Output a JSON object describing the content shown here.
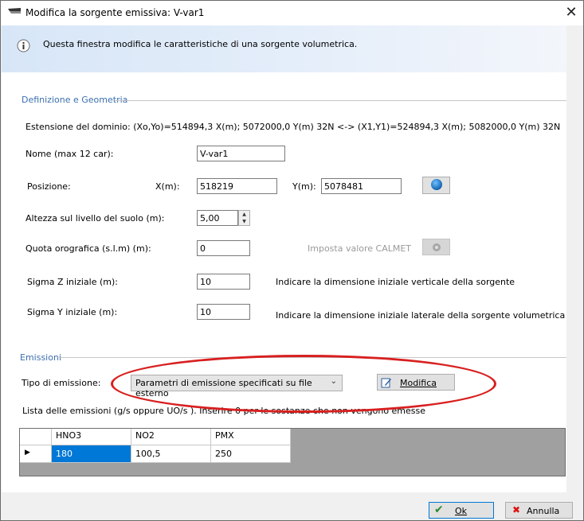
{
  "window": {
    "title": "Modifica la sorgente emissiva: V-var1",
    "close_icon": "close-icon"
  },
  "banner": {
    "text": "Questa finestra modifica le caratteristiche di una sorgente volumetrica.",
    "icon": "info-icon"
  },
  "geometry": {
    "group_title": "Definizione e Geometria",
    "domain_extent": "Estensione del dominio: (Xo,Yo)=514894,3 X(m); 5072000,0 Y(m) 32N  <-> (X1,Y1)=524894,3 X(m); 5082000,0 Y(m) 32N",
    "name_label": "Nome (max 12 car):",
    "name_value": "V-var1",
    "position_label": "Posizione:",
    "x_label": "X(m):",
    "x_value": "518219",
    "y_label": "Y(m):",
    "y_value": "5078481",
    "globe_icon": "globe-icon",
    "height_label": "Altezza sul livello del suolo (m):",
    "height_value": "5,00",
    "quota_label": "Quota orografica (s.l.m)  (m):",
    "quota_value": "0",
    "calmet_label": "Imposta valore CALMET",
    "calmet_icon": "settings-icon",
    "sigmaz_label": "Sigma Z  iniziale (m):",
    "sigmaz_value": "10",
    "sigmaz_hint": "Indicare la dimensione iniziale verticale della sorgente",
    "sigmay_label": "Sigma Y iniziale (m):",
    "sigmay_value": "10",
    "sigmay_hint": "Indicare la dimensione iniziale laterale della sorgente volumetrica"
  },
  "emissions": {
    "group_title": "Emissioni",
    "type_label": "Tipo di emissione:",
    "type_value": "Parametri di emissione specificati su file esterno",
    "modify_button": "Modifica",
    "modify_icon": "edit-icon",
    "list_label": "Lista delle emissioni (g/s oppure UO/s ). Inserire 0 per le sostanze che non vengono emesse",
    "columns": [
      "HNO3",
      "NO2",
      "PMX"
    ],
    "rows": [
      [
        "180",
        "100,5",
        "250"
      ]
    ],
    "row_marker_icon": "row-pointer-icon"
  },
  "footer": {
    "ok_label": "Ok",
    "ok_icon": "check-icon",
    "cancel_label": "Annulla",
    "cancel_icon": "x-icon"
  },
  "annotation": {
    "color": "#d81f1f"
  }
}
